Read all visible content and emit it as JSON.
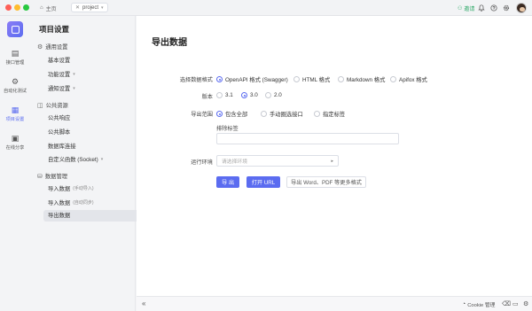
{
  "titlebar": {
    "home_label": "主页",
    "project_tab_label": "project",
    "invite_label": "邀请"
  },
  "rail": {
    "items": [
      {
        "label": "接口管理",
        "icon": "api-icon"
      },
      {
        "label": "自动化测试",
        "icon": "auto-test-icon"
      },
      {
        "label": "项目设置",
        "icon": "settings-icon",
        "active": true
      },
      {
        "label": "在线分享",
        "icon": "share-icon"
      }
    ]
  },
  "sidebar": {
    "title": "项目设置",
    "groups": [
      {
        "label": "通用设置",
        "items": [
          "基本设置",
          "功能设置",
          "通知设置"
        ]
      },
      {
        "label": "公共资源",
        "items": [
          "公共响应",
          "公共脚本",
          "数据库连接",
          "自定义函数 (Socket)"
        ]
      },
      {
        "label": "数据管理",
        "items": [
          "导入数据",
          "导入数据",
          "导出数据"
        ]
      }
    ],
    "sub_notes": {
      "import_manual": "(手动导入)",
      "import_auto": "(自动同步)"
    }
  },
  "main": {
    "title": "导出数据",
    "format": {
      "label": "选择数据格式",
      "options": [
        "OpenAPI 格式 (Swagger)",
        "HTML 格式",
        "Markdown 格式",
        "Apifox 格式"
      ],
      "selected": "OpenAPI 格式 (Swagger)"
    },
    "version": {
      "label": "版本",
      "options": [
        "3.1",
        "3.0",
        "2.0"
      ],
      "selected": "3.0"
    },
    "scope": {
      "label": "导出范围",
      "options": [
        "包含全部",
        "手动圈选接口",
        "指定标签"
      ],
      "selected": "包含全部"
    },
    "exclude_tags": {
      "label": "排除标签",
      "value": ""
    },
    "environment": {
      "label": "运行环境",
      "placeholder": "请选择环境"
    },
    "buttons": {
      "export": "导 出",
      "open_url": "打开 URL",
      "more": "导出 Word、PDF 等更多格式"
    }
  },
  "bottombar": {
    "collapse_icon": "double-chevron-left-icon",
    "cookie_label": "Cookie 管理"
  },
  "colors": {
    "accent": "#5b6cf0",
    "invite": "#2fa968"
  }
}
